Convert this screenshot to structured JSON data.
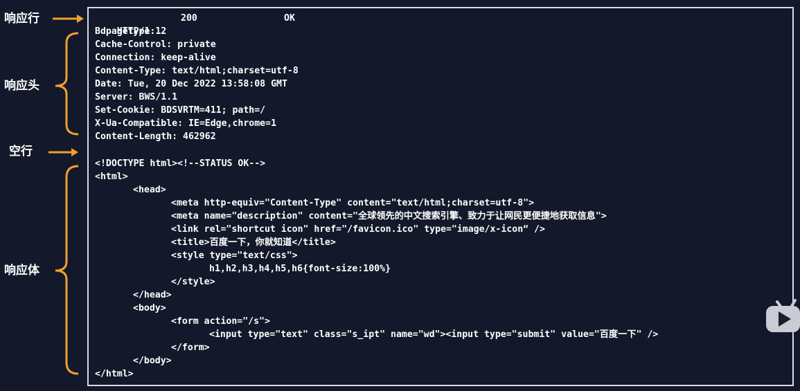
{
  "annotations": {
    "response_line": "响应行",
    "response_headers": "响应头",
    "blank_line": "空行",
    "response_body": "响应体"
  },
  "response": {
    "status_line": {
      "version": "HTTP/1.1",
      "code": "200",
      "reason": "OK"
    },
    "headers": [
      "Bdpagetype: 2",
      "Cache-Control: private",
      "Connection: keep-alive",
      "Content-Type: text/html;charset=utf-8",
      "Date: Tue, 20 Dec 2022 13:58:08 GMT",
      "Server: BWS/1.1",
      "Set-Cookie: BDSVRTM=411; path=/",
      "X-Ua-Compatible: IE=Edge,chrome=1",
      "Content-Length: 462962"
    ],
    "body": [
      {
        "indent": 0,
        "text": "<!DOCTYPE html><!--STATUS OK-->"
      },
      {
        "indent": 0,
        "text": "<html>"
      },
      {
        "indent": 1,
        "text": "<head>"
      },
      {
        "indent": 2,
        "text": "<meta http-equiv=\"Content-Type\" content=\"text/html;charset=utf-8\">"
      },
      {
        "indent": 2,
        "text": "<meta name=\"description\" content=\"全球领先的中文搜索引擎、致力于让网民更便捷地获取信息\">"
      },
      {
        "indent": 2,
        "text": "<link rel=\"shortcut icon\" href=\"/favicon.ico\" type=\"image/x-icon“ />"
      },
      {
        "indent": 2,
        "text": "<title>百度一下，你就知道</title>"
      },
      {
        "indent": 2,
        "text": "<style type=\"text/css\">"
      },
      {
        "indent": 3,
        "text": "h1,h2,h3,h4,h5,h6{font-size:100%}"
      },
      {
        "indent": 2,
        "text": "</style>"
      },
      {
        "indent": 1,
        "text": "</head>"
      },
      {
        "indent": 1,
        "text": "<body>"
      },
      {
        "indent": 2,
        "text": "<form action=\"/s\">"
      },
      {
        "indent": 3,
        "text": "<input type=\"text\" class=\"s_ipt\" name=\"wd\"><input type=\"submit\" value=\"百度一下\" />"
      },
      {
        "indent": 2,
        "text": "</form>"
      },
      {
        "indent": 1,
        "text": "</body>"
      },
      {
        "indent": 0,
        "text": "</html>"
      }
    ]
  },
  "colors": {
    "background": "#13192a",
    "accent_orange": "#f0a030",
    "text": "#ffffff",
    "border": "#d9dde3"
  },
  "icons": {
    "video_player": "play-icon"
  }
}
